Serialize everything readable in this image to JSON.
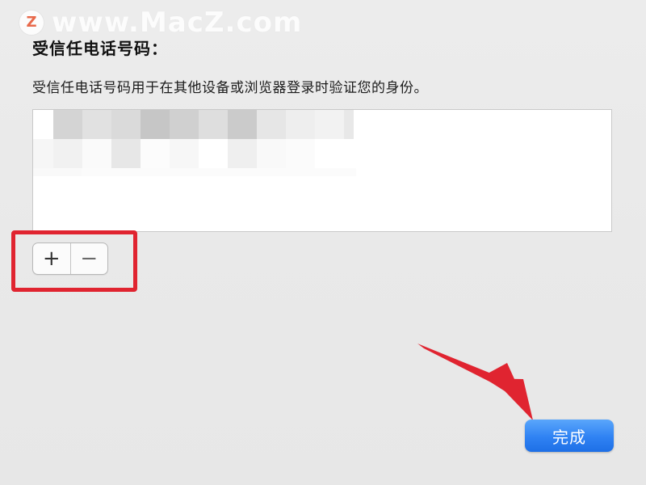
{
  "watermark": {
    "logo_letter": "Z",
    "text": "www.MacZ.com"
  },
  "header": {
    "title": "受信任电话号码：",
    "description": "受信任电话号码用于在其他设备或浏览器登录时验证您的身份。"
  },
  "phone_list": {
    "content_state": "pixelated"
  },
  "controls": {
    "add_label": "+",
    "remove_label": "−"
  },
  "footer": {
    "done_label": "完成"
  },
  "colors": {
    "annotation_red": "#e02430",
    "accent_blue": "#2f82f3"
  },
  "icons": {
    "add": "plus-icon",
    "remove": "minus-icon",
    "annotation": "red-arrow-icon"
  }
}
